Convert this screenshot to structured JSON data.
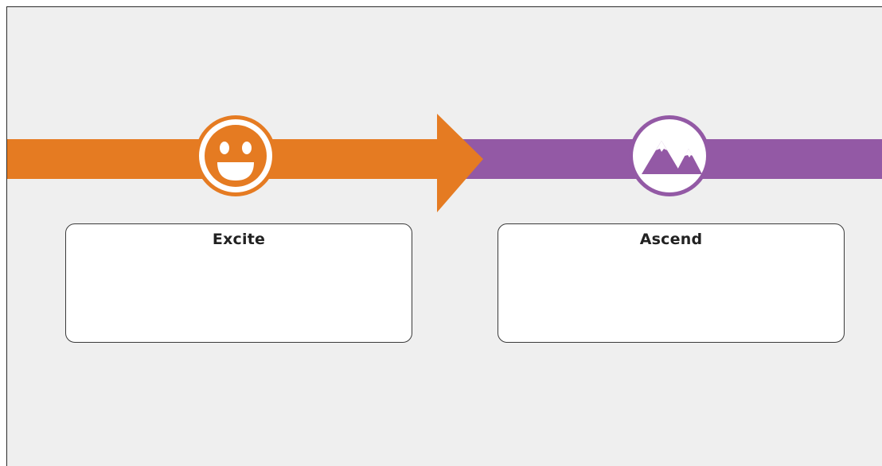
{
  "colors": {
    "background": "#efefef",
    "stage1": "#e57b22",
    "stage2": "#9359a5",
    "card_border": "#3a3a3a"
  },
  "stages": [
    {
      "label": "Excite",
      "icon": "smiley-icon",
      "body": ""
    },
    {
      "label": "Ascend",
      "icon": "mountains-icon",
      "body": ""
    }
  ]
}
